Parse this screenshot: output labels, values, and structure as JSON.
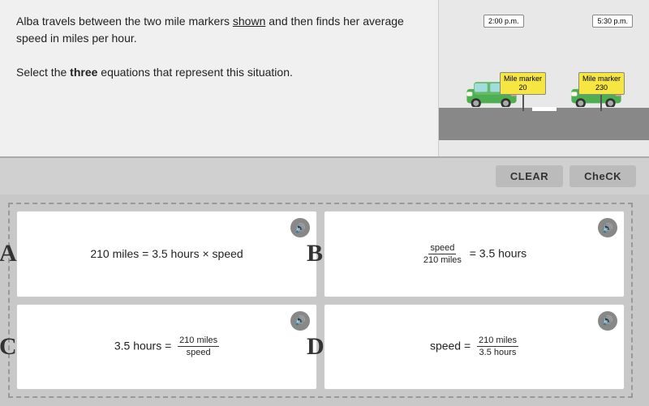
{
  "top": {
    "problem_text_1": "Alba travels between the two mile markers",
    "shown_link": "shown",
    "problem_text_2": " and then finds her average speed in miles per hour.",
    "instruction_pre": "Select the ",
    "instruction_bold": "three",
    "instruction_post": " equations that represent this situation.",
    "time_left": "2:00 p.m.",
    "time_right": "5:30 p.m.",
    "marker_left_label": "Mile marker",
    "marker_left_num": "20",
    "marker_right_label": "Mile marker",
    "marker_right_num": "230"
  },
  "buttons": {
    "clear_label": "CLEAR",
    "check_label": "CheCK"
  },
  "options": [
    {
      "id": "A",
      "equation_display": "A",
      "eq_text": "210 miles = 3.5 hours × speed"
    },
    {
      "id": "B",
      "equation_display": "B",
      "eq_text": "speed / 210 miles = 3.5 hours"
    },
    {
      "id": "C",
      "equation_display": "C",
      "eq_text": "3.5 hours = 210 miles / speed"
    },
    {
      "id": "D",
      "equation_display": "D",
      "eq_text": "speed = 210 miles / 3.5 hours"
    }
  ]
}
